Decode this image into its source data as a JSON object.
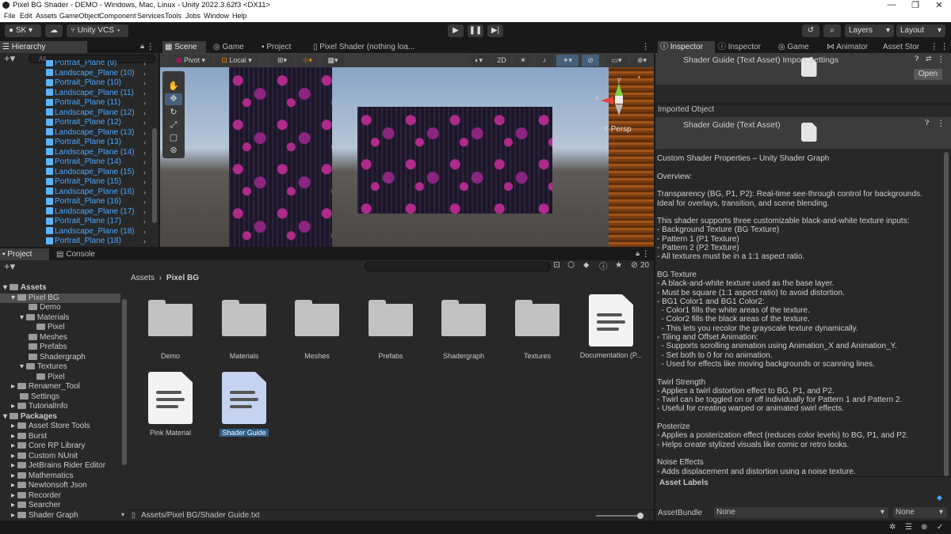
{
  "window": {
    "title": "Pixel BG Shader - DEMO - Windows, Mac, Linux - Unity 2022.3.62f3 <DX11>",
    "controls": [
      "—",
      "❐",
      "✕"
    ]
  },
  "menu": [
    "File",
    "Edit",
    "Assets",
    "GameObject",
    "Component",
    "Services",
    "Tools",
    "Jobs",
    "Window",
    "Help"
  ],
  "toolbar": {
    "account": "SK",
    "vcs": "Unity VCS",
    "layers": "Layers",
    "layout": "Layout"
  },
  "hierarchy": {
    "tab": "Hierarchy",
    "search_placeholder": "All",
    "items": [
      "Portrait_Plane (9)",
      "Landscape_Plane (10)",
      "Portrait_Plane (10)",
      "Landscape_Plane (11)",
      "Portrait_Plane (11)",
      "Landscape_Plane (12)",
      "Portrait_Plane (12)",
      "Landscape_Plane (13)",
      "Portrait_Plane (13)",
      "Landscape_Plane (14)",
      "Portrait_Plane (14)",
      "Landscape_Plane (15)",
      "Portrait_Plane (15)",
      "Landscape_Plane (16)",
      "Portrait_Plane (16)",
      "Landscape_Plane (17)",
      "Portrait_Plane (17)",
      "Landscape_Plane (18)",
      "Portrait_Plane (18)"
    ]
  },
  "scene": {
    "tabs": [
      "Scene",
      "Game",
      "Project",
      "Pixel Shader (nothing loa..."
    ],
    "pivot": "Pivot",
    "local": "Local",
    "mode_2d": "2D",
    "persp": "< Persp",
    "axis_x": "x",
    "axis_y": "y"
  },
  "project": {
    "tabs": [
      "Project",
      "Console"
    ],
    "hidden_count": "20",
    "breadcrumb": [
      "Assets",
      "Pixel BG"
    ],
    "tree": [
      {
        "label": "Assets",
        "level": 0,
        "bold": true
      },
      {
        "label": "Pixel BG",
        "level": 1,
        "selected": true
      },
      {
        "label": "Demo",
        "level": 2
      },
      {
        "label": "Materials",
        "level": 2
      },
      {
        "label": "Pixel",
        "level": 3
      },
      {
        "label": "Meshes",
        "level": 2
      },
      {
        "label": "Prefabs",
        "level": 2
      },
      {
        "label": "Shadergraph",
        "level": 2
      },
      {
        "label": "Textures",
        "level": 2
      },
      {
        "label": "Pixel",
        "level": 3
      },
      {
        "label": "Renamer_Tool",
        "level": 1
      },
      {
        "label": "Settings",
        "level": 1
      },
      {
        "label": "TutorialInfo",
        "level": 1
      },
      {
        "label": "Packages",
        "level": 0,
        "bold": true
      },
      {
        "label": "Asset Store Tools",
        "level": 1
      },
      {
        "label": "Burst",
        "level": 1
      },
      {
        "label": "Core RP Library",
        "level": 1
      },
      {
        "label": "Custom NUnit",
        "level": 1
      },
      {
        "label": "JetBrains Rider Editor",
        "level": 1
      },
      {
        "label": "Mathematics",
        "level": 1
      },
      {
        "label": "Newtonsoft Json",
        "level": 1
      },
      {
        "label": "Recorder",
        "level": 1
      },
      {
        "label": "Searcher",
        "level": 1
      },
      {
        "label": "Shader Graph",
        "level": 1
      }
    ],
    "assets": [
      {
        "label": "Demo",
        "kind": "folder"
      },
      {
        "label": "Materials",
        "kind": "folder"
      },
      {
        "label": "Meshes",
        "kind": "folder"
      },
      {
        "label": "Prefabs",
        "kind": "folder"
      },
      {
        "label": "Shadergraph",
        "kind": "folder"
      },
      {
        "label": "Textures",
        "kind": "folder"
      },
      {
        "label": "Documentation (P...",
        "kind": "doc"
      },
      {
        "label": "Pink Material",
        "kind": "doc"
      },
      {
        "label": "Shader Guide",
        "kind": "doc",
        "selected": true
      }
    ],
    "status_path": "Assets/Pixel BG/Shader Guide.txt"
  },
  "inspector": {
    "tabs": [
      "Inspector",
      "Inspector",
      "Game",
      "Animator",
      "Asset Stor"
    ],
    "header_title": "Shader Guide (Text Asset) Import Settings",
    "open_button": "Open",
    "imported_object": "Imported Object",
    "sub_title": "Shader Guide (Text Asset)",
    "text_lines": [
      "Custom Shader Properties – Unity Shader Graph",
      "",
      "Overview:",
      "",
      "Transparency (BG, P1, P2): Real-time see-through control for backgrounds.",
      "Ideal for overlays, transition, and scene blending.",
      "",
      "This shader supports three customizable black-and-white texture inputs:",
      "- Background Texture (BG Texture)",
      "- Pattern 1 (P1 Texture)",
      "- Pattern 2 (P2 Texture)",
      "- All textures must be in a 1:1 aspect ratio.",
      "",
      "BG Texture",
      "- A black-and-white texture used as the base layer.",
      "- Must be square (1:1 aspect ratio) to avoid distortion.",
      "- BG1 Color1 and BG1 Color2:",
      "  - Color1 fills the white areas of the texture.",
      "  - Color2 fills the black areas of the texture.",
      "  - This lets you recolor the grayscale texture dynamically.",
      "- Tiling and Offset Animation:",
      "  - Supports scrolling animation using Animation_X and Animation_Y.",
      "  - Set both to 0 for no animation.",
      "  - Used for effects like moving backgrounds or scanning lines.",
      "",
      "Twirl Strength",
      "- Applies a twirl distortion effect to BG, P1, and P2.",
      "- Twirl can be toggled on or off individually for Pattern 1 and Pattern 2.",
      "- Useful for creating warped or animated swirl effects.",
      "",
      "Posterize",
      "- Applies a posterization effect (reduces color levels) to BG, P1, and P2.",
      "- Helps create stylized visuals like comic or retro looks.",
      "",
      "Noise Effects",
      "- Adds displacement and distortion using a noise texture."
    ],
    "asset_labels": "Asset Labels",
    "assetbundle_label": "AssetBundle",
    "assetbundle_value": "None",
    "assetbundle_variant": "None"
  },
  "colors": {
    "accent_blue": "#4aa7ff",
    "selection": "#2c5d87",
    "pattern_bg": "#1d1628",
    "pattern_pink": "#b02a8c",
    "sky": "#8aa4c6",
    "ground": "#5a5654"
  }
}
